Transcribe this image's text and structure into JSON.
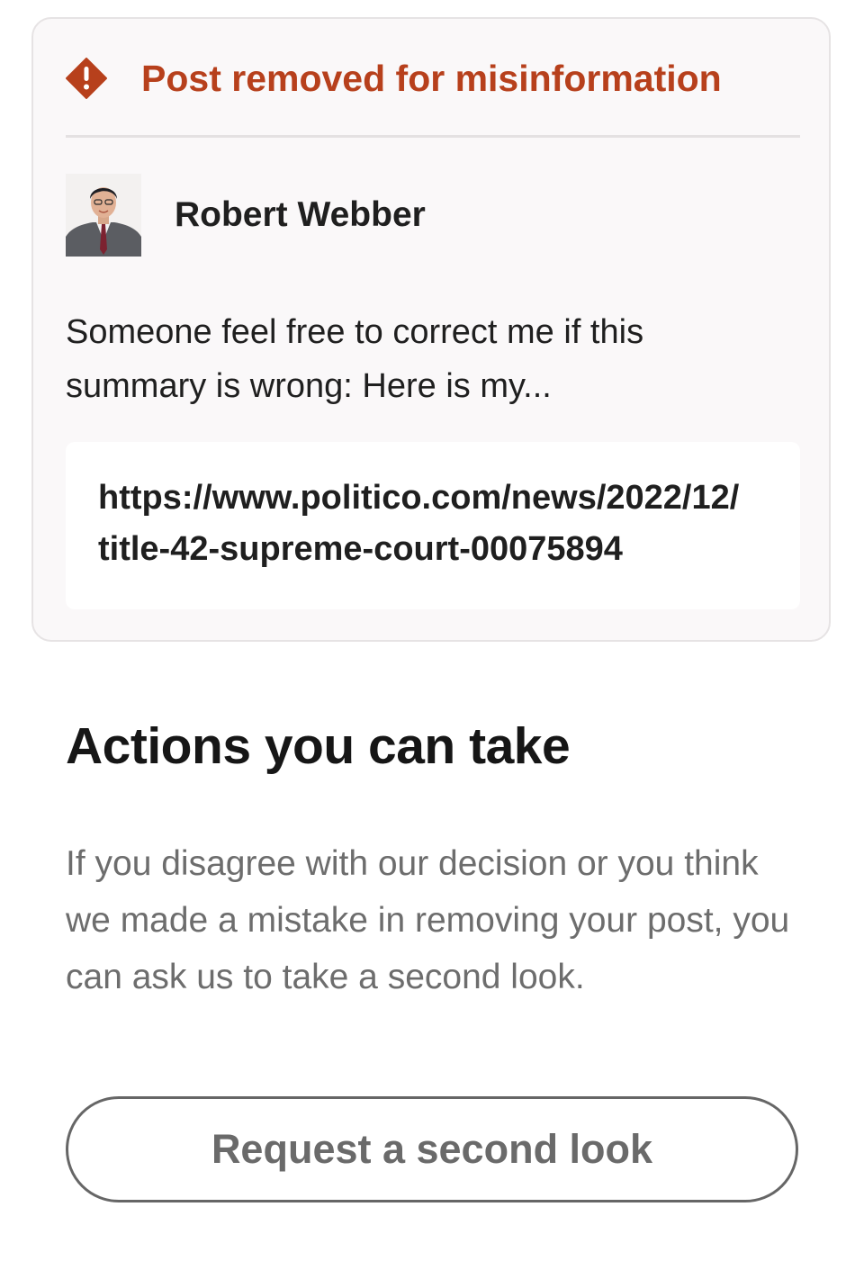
{
  "notice": {
    "title": "Post removed for misinformation",
    "icon": "warning-icon",
    "accent_color": "#b7401c"
  },
  "post": {
    "author_name": "Robert Webber",
    "text": "Someone feel free to correct me if this summary is wrong: Here is my...",
    "link": "https://www.politico.com/news/2022/12/\ntitle-42-supreme-court-00075894"
  },
  "actions": {
    "heading": "Actions you can take",
    "body": "If you disagree with our decision or you think we made a mistake in removing your post, you can ask us to take a second look.",
    "button_label": "Request a second look"
  }
}
